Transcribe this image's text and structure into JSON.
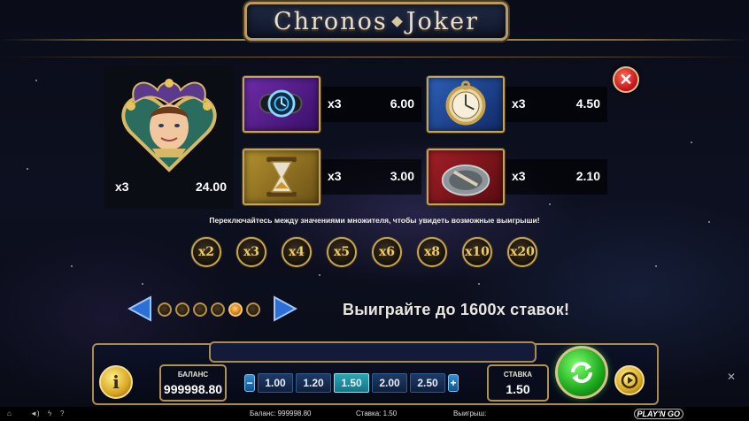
{
  "logo": {
    "word1": "Chronos",
    "word2": "Joker"
  },
  "paytable": {
    "jester": {
      "multiplier": "x3",
      "value": "24.00"
    },
    "rows": [
      {
        "symbol": "wrist-device",
        "multiplier": "x3",
        "value": "6.00"
      },
      {
        "symbol": "pocket-watch",
        "multiplier": "x3",
        "value": "4.50"
      },
      {
        "symbol": "hourglass",
        "multiplier": "x3",
        "value": "3.00"
      },
      {
        "symbol": "sundial",
        "multiplier": "x3",
        "value": "2.10"
      }
    ]
  },
  "close_label": "✕",
  "hint": "Переключайтесь между значениями множителя, чтобы увидеть возможные выигрыши!",
  "multiplier_options": [
    "x2",
    "x3",
    "x4",
    "x5",
    "x6",
    "x8",
    "x10",
    "x20"
  ],
  "pagination": {
    "total": 6,
    "active_index": 4
  },
  "win_text": "Выиграйте до 1600х ставок!",
  "console": {
    "info_label": "i",
    "balance_label": "БАЛАНС",
    "balance_value": "999998.80",
    "minus": "−",
    "plus": "+",
    "bets": [
      "1.00",
      "1.20",
      "1.50",
      "2.00",
      "2.50"
    ],
    "active_bet_index": 2,
    "stake_label": "СТАВКА",
    "stake_value": "1.50"
  },
  "status_bar": {
    "balance": "Баланс: 999998.80",
    "stake": "Ставка: 1.50",
    "win": "Выигрыш:",
    "brand": "PLAY'N GO"
  },
  "colors": {
    "gold": "#c7a659",
    "spin_green": "#1ca61c",
    "close_red": "#c6161c",
    "bet_active": "#2ba5b4"
  }
}
